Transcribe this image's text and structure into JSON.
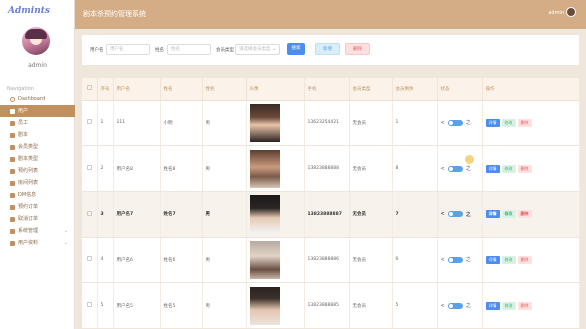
{
  "app": {
    "brand": "Admints",
    "admin_name": "admin",
    "page_title": "剧本杀预约管理系统",
    "header_user": "admin"
  },
  "sidebar": {
    "heading": "Navigation",
    "items": [
      {
        "label": "Dashboard",
        "active": false
      },
      {
        "label": "用户",
        "active": true
      },
      {
        "label": "员工",
        "active": false
      },
      {
        "label": "剧本",
        "active": false
      },
      {
        "label": "会员类型",
        "active": false
      },
      {
        "label": "剧本类型",
        "active": false
      },
      {
        "label": "预约列表",
        "active": false
      },
      {
        "label": "房间列表",
        "active": false
      },
      {
        "label": "DM信息",
        "active": false
      },
      {
        "label": "预约订单",
        "active": false
      },
      {
        "label": "取消订单",
        "active": false
      },
      {
        "label": "系统管理",
        "active": false,
        "expandable": true
      },
      {
        "label": "用户资料",
        "active": false,
        "expandable": true
      }
    ]
  },
  "search": {
    "username_label": "用户名",
    "username_placeholder": "用户名",
    "name_label": "姓名",
    "name_placeholder": "姓名",
    "member_type_label": "会员类型",
    "member_type_placeholder": "请选择会员类型",
    "search_button": "搜索",
    "add_button": "新增",
    "delete_button": "删除"
  },
  "table": {
    "columns": [
      "",
      "序号",
      "用户名",
      "姓名",
      "性别",
      "头像",
      "手机",
      "会员类型",
      "会员剩余",
      "状态",
      "操作"
    ],
    "status_toggle_left": "<",
    "status_toggle_right": "之",
    "actions": {
      "detail": "详情",
      "edit": "修改",
      "remove": "删除"
    },
    "rows": [
      {
        "index": "1",
        "username": "111",
        "name": "小明",
        "gender": "男",
        "phone": "13623254421",
        "member_type": "无会员",
        "remaining": "1",
        "photo": "p1"
      },
      {
        "index": "2",
        "username": "用户名8",
        "name": "姓名8",
        "gender": "男",
        "phone": "13823888888",
        "member_type": "无会员",
        "remaining": "8",
        "photo": "p2"
      },
      {
        "index": "3",
        "username": "用户名7",
        "name": "姓名7",
        "gender": "男",
        "phone": "13823888887",
        "member_type": "无会员",
        "remaining": "7",
        "photo": "p3"
      },
      {
        "index": "4",
        "username": "用户名6",
        "name": "姓名6",
        "gender": "男",
        "phone": "13823888886",
        "member_type": "无会员",
        "remaining": "6",
        "photo": "p4"
      },
      {
        "index": "5",
        "username": "用户名5",
        "name": "姓名5",
        "gender": "男",
        "phone": "13823888885",
        "member_type": "无会员",
        "remaining": "5",
        "photo": "p5"
      }
    ]
  },
  "colors": {
    "header": "#d4ad86",
    "accent": "#c0915f",
    "primary_button": "#4d8cf0"
  }
}
